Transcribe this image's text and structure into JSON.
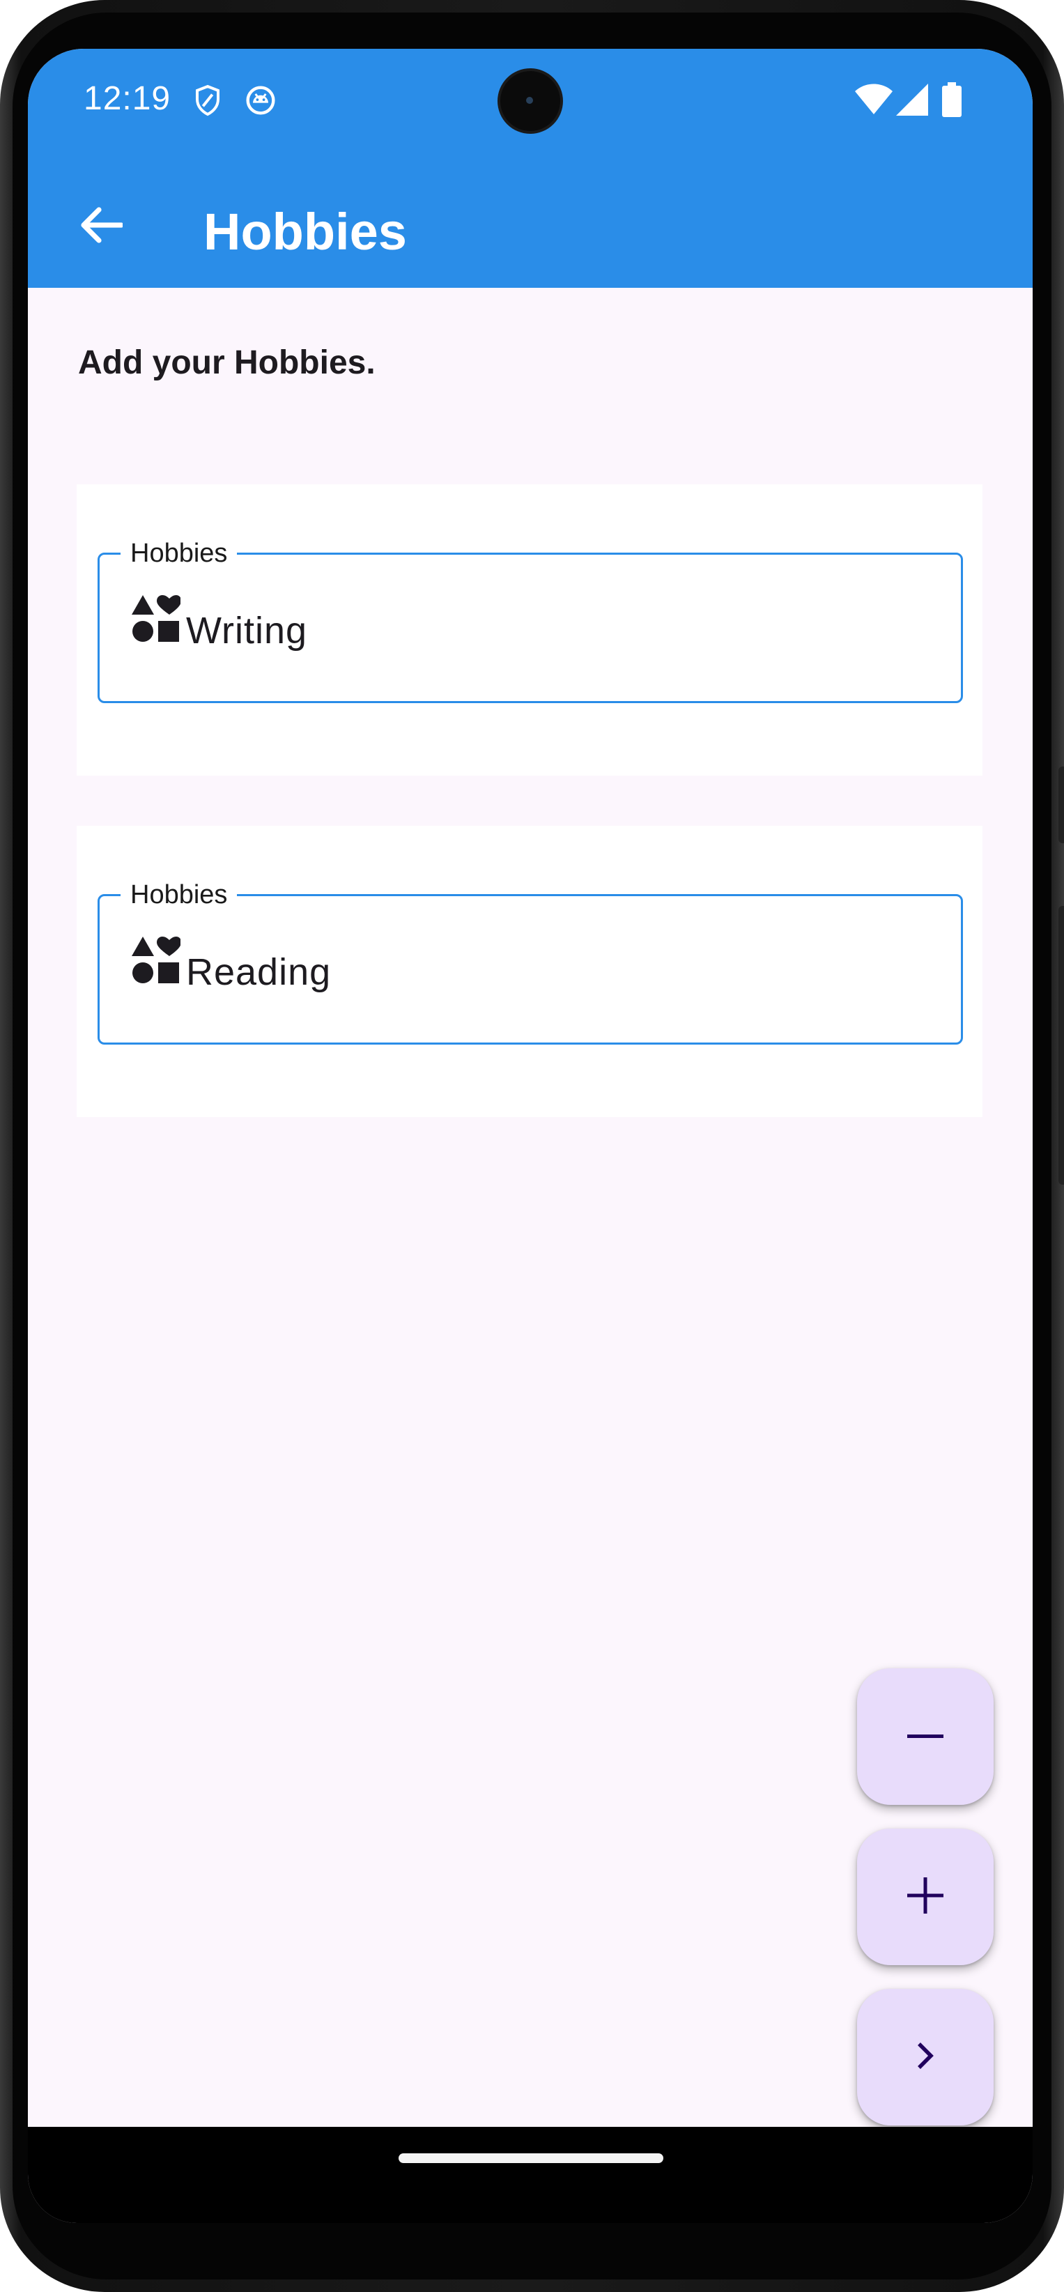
{
  "status_bar": {
    "time": "12:19",
    "icons": [
      "shield-icon",
      "android-face-icon",
      "wifi-icon",
      "cellular-signal-icon",
      "battery-icon"
    ]
  },
  "app_bar": {
    "title": "Hobbies",
    "back_icon": "arrow-back-icon",
    "color": "#2a8de8"
  },
  "main": {
    "subtitle": "Add your Hobbies.",
    "hobbies": [
      {
        "label": "Hobbies",
        "value": "Writing",
        "icon": "interests-icon"
      },
      {
        "label": "Hobbies",
        "value": "Reading",
        "icon": "interests-icon"
      }
    ]
  },
  "fabs": [
    {
      "name": "remove-hobby-button",
      "icon": "minus-icon"
    },
    {
      "name": "add-hobby-button",
      "icon": "plus-icon"
    },
    {
      "name": "next-button",
      "icon": "chevron-right-icon"
    }
  ],
  "colors": {
    "accent": "#2a8de8",
    "background": "#fcf6fd",
    "fab": "#e8dcfb",
    "fab_icon": "#21005d"
  }
}
